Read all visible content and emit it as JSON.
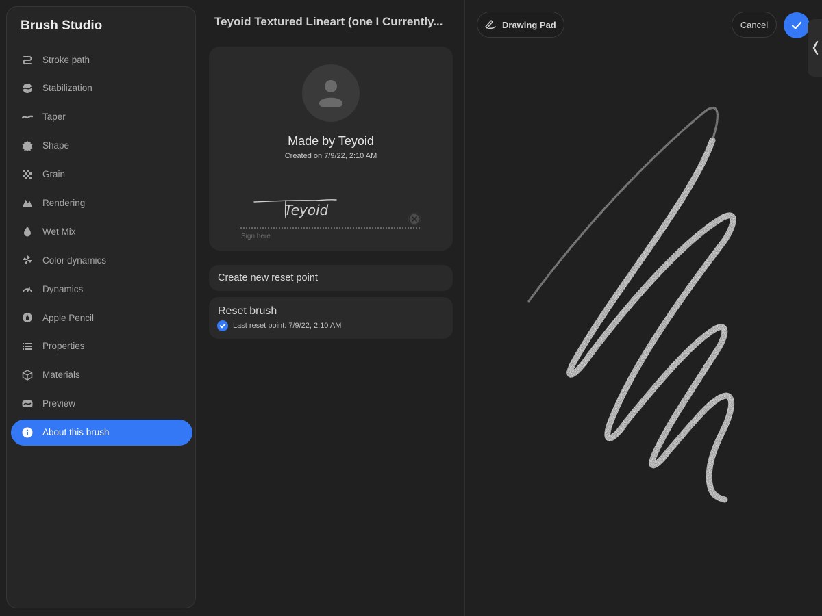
{
  "sidebar": {
    "title": "Brush Studio",
    "items": [
      {
        "label": "Stroke path",
        "icon": "stroke-path-icon"
      },
      {
        "label": "Stabilization",
        "icon": "stabilization-icon"
      },
      {
        "label": "Taper",
        "icon": "taper-icon"
      },
      {
        "label": "Shape",
        "icon": "shape-icon"
      },
      {
        "label": "Grain",
        "icon": "grain-icon"
      },
      {
        "label": "Rendering",
        "icon": "rendering-icon"
      },
      {
        "label": "Wet Mix",
        "icon": "wet-mix-icon"
      },
      {
        "label": "Color dynamics",
        "icon": "color-dynamics-icon"
      },
      {
        "label": "Dynamics",
        "icon": "dynamics-icon"
      },
      {
        "label": "Apple Pencil",
        "icon": "apple-pencil-icon"
      },
      {
        "label": "Properties",
        "icon": "properties-icon"
      },
      {
        "label": "Materials",
        "icon": "materials-icon"
      },
      {
        "label": "Preview",
        "icon": "preview-icon"
      },
      {
        "label": "About this brush",
        "icon": "info-icon",
        "active": true
      }
    ]
  },
  "brush": {
    "title": "Teyoid Textured Lineart (one I Currently..."
  },
  "author": {
    "made_by": "Made by Teyoid",
    "created_on": "Created on 7/9/22, 2:10 AM",
    "signature": "Teyoid",
    "sign_here": "Sign here"
  },
  "actions": {
    "create_reset_point": "Create new reset point",
    "reset_brush": "Reset brush",
    "last_reset_point": "Last reset point: 7/9/22, 2:10 AM"
  },
  "toolbar": {
    "drawing_pad": "Drawing Pad",
    "cancel": "Cancel"
  },
  "colors": {
    "accent": "#3478f6",
    "background": "#202020",
    "panel": "#262626",
    "card": "#2a2a2a"
  }
}
